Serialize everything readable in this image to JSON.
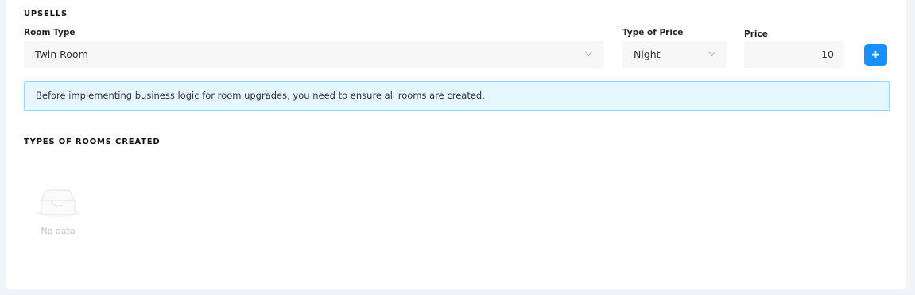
{
  "upsells": {
    "title": "UPSELLS",
    "room_type": {
      "label": "Room Type",
      "value": "Twin Room"
    },
    "type_of_price": {
      "label": "Type of Price",
      "value": "Night"
    },
    "price": {
      "label": "Price",
      "value": "10"
    },
    "add_button_label": "+",
    "info_message": "Before implementing business logic for room upgrades, you need to ensure all rooms are created."
  },
  "rooms_created": {
    "title": "TYPES OF ROOMS CREATED",
    "empty_text": "No data",
    "empty_icon": "inbox-icon"
  },
  "colors": {
    "accent": "#1890ff",
    "info_background": "#e6f7ff",
    "info_border": "#91d5ff",
    "page_background": "#f0f4f8"
  }
}
